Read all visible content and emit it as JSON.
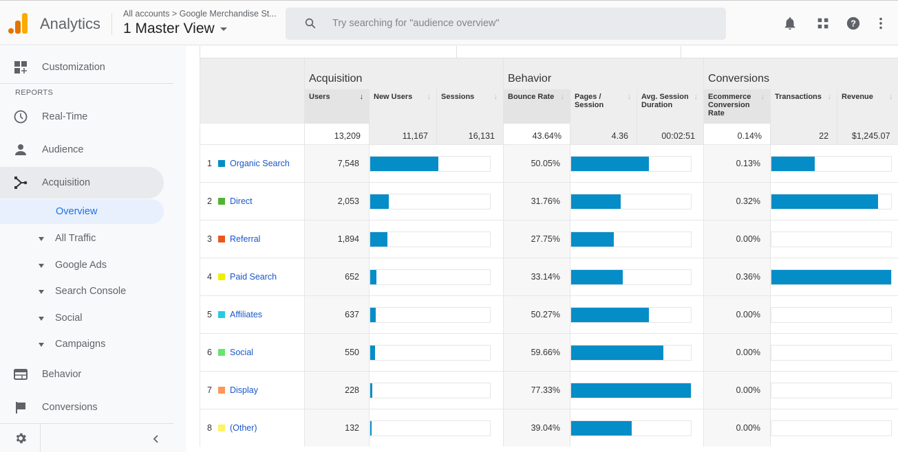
{
  "header": {
    "app_name": "Analytics",
    "breadcrumb": "All accounts > Google Merchandise St...",
    "view_name": "1 Master View",
    "search_placeholder": "Try searching for \"audience overview\"",
    "icons": [
      "bell-icon",
      "apps-grid-icon",
      "help-icon",
      "more-vert-icon"
    ]
  },
  "sidebar": {
    "customization": "Customization",
    "reports_label": "REPORTS",
    "items": [
      {
        "label": "Real-Time",
        "icon": "clock-icon"
      },
      {
        "label": "Audience",
        "icon": "person-icon"
      },
      {
        "label": "Acquisition",
        "icon": "acquisition-icon"
      }
    ],
    "acquisition_sub": {
      "overview": "Overview",
      "children": [
        "All Traffic",
        "Google Ads",
        "Search Console",
        "Social",
        "Campaigns"
      ]
    },
    "bottom_items": [
      {
        "label": "Behavior",
        "icon": "behavior-icon"
      },
      {
        "label": "Conversions",
        "icon": "flag-icon"
      }
    ]
  },
  "table": {
    "groups": [
      "Acquisition",
      "Behavior",
      "Conversions"
    ],
    "columns": [
      "Users",
      "New Users",
      "Sessions",
      "Bounce Rate",
      "Pages / Session",
      "Avg. Session Duration",
      "Ecommerce Conversion Rate",
      "Transactions",
      "Revenue"
    ],
    "sort_icon": "↓",
    "totals": [
      "13,209",
      "11,167",
      "16,131",
      "43.64%",
      "4.36",
      "00:02:51",
      "0.14%",
      "22",
      "$1,245.07"
    ],
    "rows": [
      {
        "rank": "1",
        "channel": "Organic Search",
        "color": "#058dc7",
        "users": "7,548",
        "users_bar": 0.571,
        "bounce": "50.05%",
        "bounce_bar": 0.647,
        "conv": "0.13%",
        "conv_bar": 0.361
      },
      {
        "rank": "2",
        "channel": "Direct",
        "color": "#50b432",
        "users": "2,053",
        "users_bar": 0.155,
        "bounce": "31.76%",
        "bounce_bar": 0.411,
        "conv": "0.32%",
        "conv_bar": 0.889
      },
      {
        "rank": "3",
        "channel": "Referral",
        "color": "#ed561b",
        "users": "1,894",
        "users_bar": 0.143,
        "bounce": "27.75%",
        "bounce_bar": 0.359,
        "conv": "0.00%",
        "conv_bar": 0
      },
      {
        "rank": "4",
        "channel": "Paid Search",
        "color": "#edef00",
        "users": "652",
        "users_bar": 0.049,
        "bounce": "33.14%",
        "bounce_bar": 0.429,
        "conv": "0.36%",
        "conv_bar": 1.0
      },
      {
        "rank": "5",
        "channel": "Affiliates",
        "color": "#24cbe5",
        "users": "637",
        "users_bar": 0.048,
        "bounce": "50.27%",
        "bounce_bar": 0.65,
        "conv": "0.00%",
        "conv_bar": 0
      },
      {
        "rank": "6",
        "channel": "Social",
        "color": "#64e572",
        "users": "550",
        "users_bar": 0.042,
        "bounce": "59.66%",
        "bounce_bar": 0.771,
        "conv": "0.00%",
        "conv_bar": 0
      },
      {
        "rank": "7",
        "channel": "Display",
        "color": "#ff9655",
        "users": "228",
        "users_bar": 0.017,
        "bounce": "77.33%",
        "bounce_bar": 1.0,
        "conv": "0.00%",
        "conv_bar": 0
      },
      {
        "rank": "8",
        "channel": "(Other)",
        "color": "#fff263",
        "users": "132",
        "users_bar": 0.01,
        "bounce": "39.04%",
        "bounce_bar": 0.505,
        "conv": "0.00%",
        "conv_bar": 0
      }
    ]
  },
  "colors": {
    "bar": "#058dc7",
    "selected_nav": "#1a73e8"
  }
}
